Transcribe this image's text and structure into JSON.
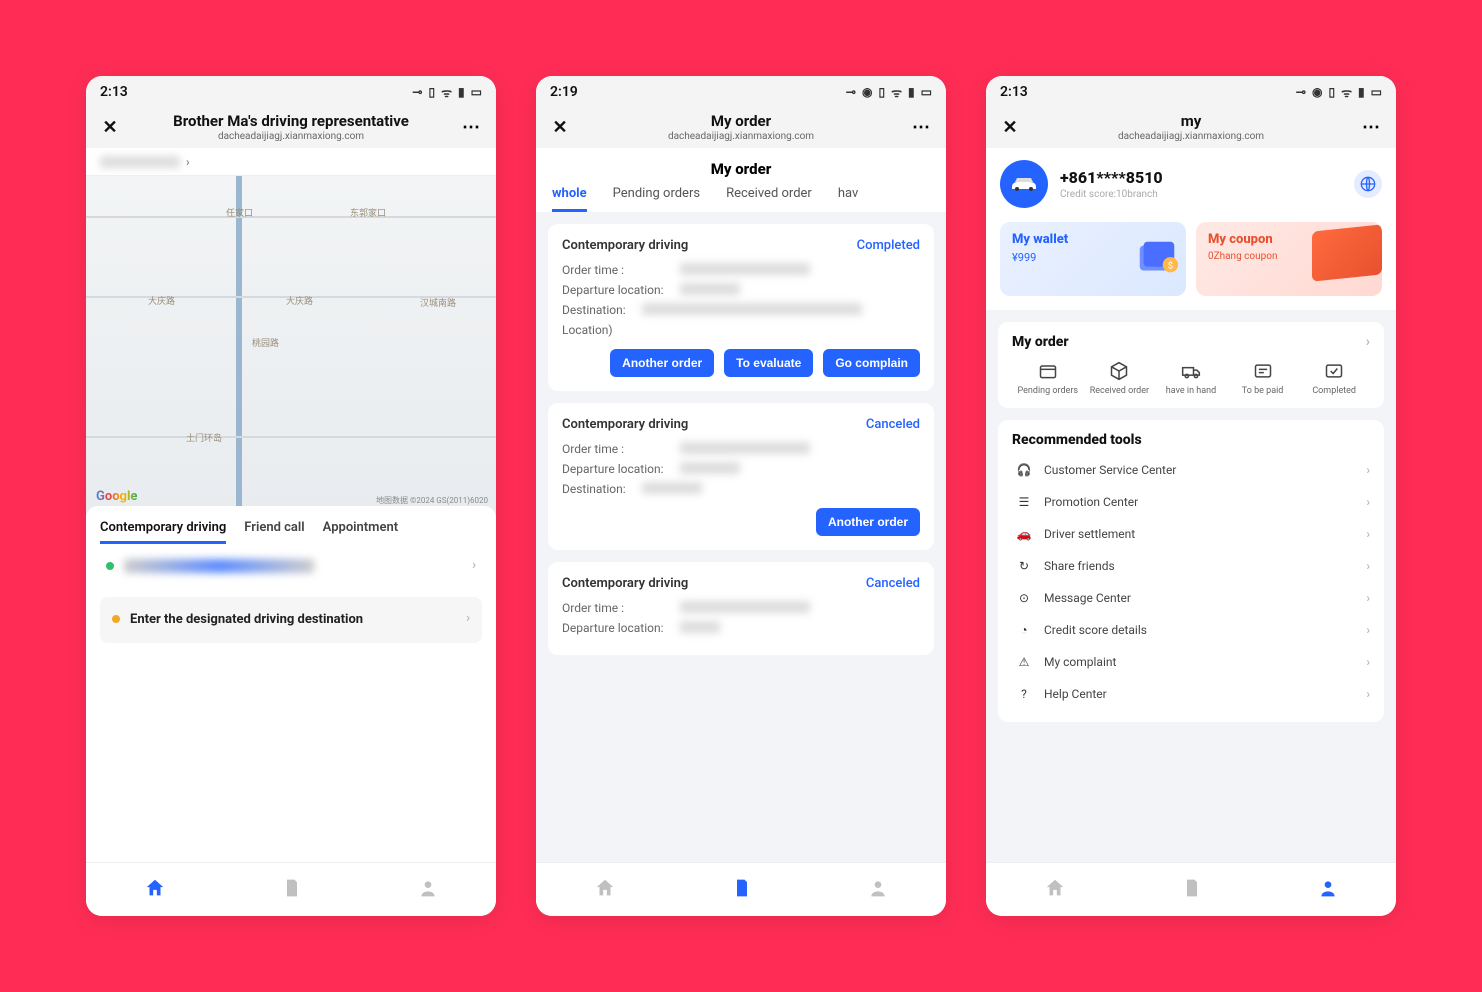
{
  "screen1": {
    "status_time": "2:13",
    "nav_title": "Brother Ma's driving representative",
    "nav_sub": "dacheadaijiagj.xianmaxiong.com",
    "map_credit": "地图数据 ©2024 GS(2011)6020",
    "map_google": "Google",
    "tabs": [
      "Contemporary driving",
      "Friend call",
      "Appointment"
    ],
    "dest_placeholder": "Enter the designated driving destination"
  },
  "screen2": {
    "status_time": "2:19",
    "nav_title": "My order",
    "nav_sub": "dacheadaijiagj.xianmaxiong.com",
    "section_title": "My order",
    "tabs": [
      "whole",
      "Pending orders",
      "Received order",
      "hav"
    ],
    "orders": [
      {
        "title": "Contemporary driving",
        "status": "Completed",
        "order_time_label": "Order time :",
        "departure_label": "Departure location:",
        "destination_label": "Destination:",
        "destination_suffix": "Location)",
        "actions": [
          "Another order",
          "To evaluate",
          "Go complain"
        ]
      },
      {
        "title": "Contemporary driving",
        "status": "Canceled",
        "order_time_label": "Order time :",
        "departure_label": "Departure location:",
        "destination_label": "Destination:",
        "actions": [
          "Another order"
        ]
      },
      {
        "title": "Contemporary driving",
        "status": "Canceled",
        "order_time_label": "Order time :",
        "departure_label": "Departure location:"
      }
    ]
  },
  "screen3": {
    "status_time": "2:13",
    "nav_title": "my",
    "nav_sub": "dacheadaijiagj.xianmaxiong.com",
    "phone": "+861****8510",
    "credit": "Credit score:10branch",
    "wallet_title": "My wallet",
    "wallet_sub": "¥999",
    "coupon_title": "My coupon",
    "coupon_sub": "0Zhang coupon",
    "order_header": "My order",
    "statuses": [
      "Pending orders",
      "Received order",
      "have in hand",
      "To be paid",
      "Completed"
    ],
    "tools_title": "Recommended tools",
    "tools": [
      "Customer Service Center",
      "Promotion Center",
      "Driver settlement",
      "Share friends",
      "Message Center",
      "Credit score details",
      "My complaint",
      "Help Center"
    ]
  }
}
